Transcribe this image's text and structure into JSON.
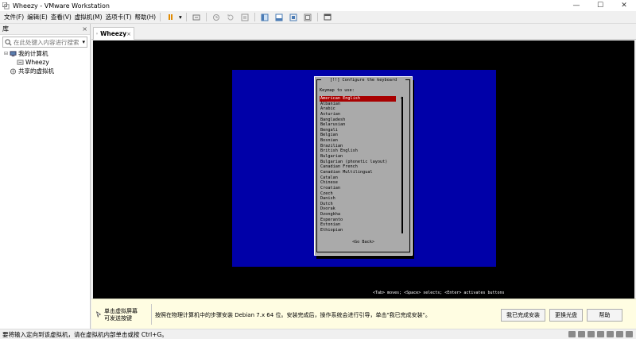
{
  "window": {
    "title": "Wheezy - VMware Workstation",
    "controls": {
      "minimize": "—",
      "maximize": "☐",
      "close": "✕"
    }
  },
  "menu": {
    "items": [
      "文件(F)",
      "编辑(E)",
      "查看(V)",
      "虚拟机(M)",
      "选项卡(T)",
      "帮助(H)"
    ],
    "dropdown_caret": "▾"
  },
  "library": {
    "title": "库",
    "close": "×",
    "search_placeholder": "在此处键入内容进行搜索",
    "search_caret": "▾",
    "tree": {
      "my_computer": "我的计算机",
      "vm": "Wheezy",
      "shared": "共享的虚拟机"
    }
  },
  "tab": {
    "label": "Wheezy",
    "close": "×"
  },
  "installer": {
    "title": "[!!] Configure the keyboard",
    "prompt": "Keymap to use:",
    "keymaps": [
      "American English",
      "Albanian",
      "Arabic",
      "Asturian",
      "Bangladesh",
      "Belarusian",
      "Bengali",
      "Belgian",
      "Bosnian",
      "Brazilian",
      "British English",
      "Bulgarian",
      "Bulgarian (phonetic layout)",
      "Canadian French",
      "Canadian Multilingual",
      "Catalan",
      "Chinese",
      "Croatian",
      "Czech",
      "Danish",
      "Dutch",
      "Dvorak",
      "Dzongkha",
      "Esperanto",
      "Estonian",
      "Ethiopian"
    ],
    "selected_index": 0,
    "scroll_arrow": "▲",
    "go_back": "<Go Back>",
    "footer": "<Tab> moves; <Space> selects; <Enter> activates buttons"
  },
  "notification": {
    "hint": "单击虚拟屏幕\n可发送按键",
    "message": "按照在物理计算机中的步骤安装 Debian 7.x 64 位。安装完成后，操作系统会进行引导，单击\"我已完成安装\"。",
    "buttons": {
      "done": "我已完成安装",
      "change_disc": "更换光盘",
      "help": "帮助"
    }
  },
  "statusbar": {
    "text": "要将输入定向到该虚拟机，请在虚拟机内部单击或按 Ctrl+G。"
  },
  "colors": {
    "vm_background": "#0000a8",
    "dialog_background": "#aaaaaa",
    "selection": "#a80000",
    "notification_background": "#fffde2"
  }
}
